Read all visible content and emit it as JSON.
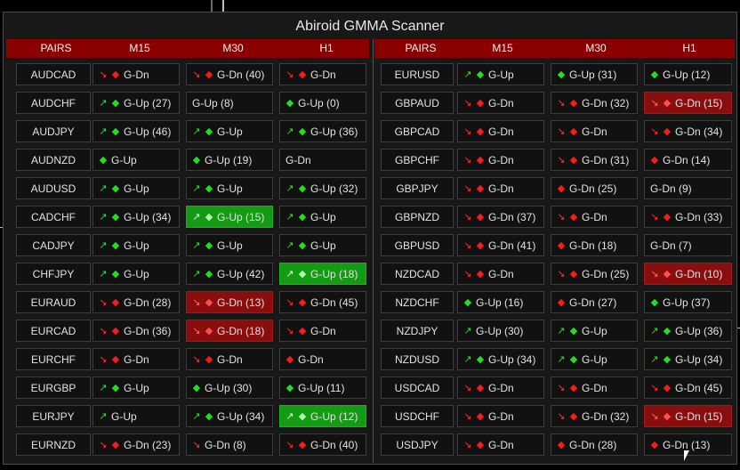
{
  "title": "Abiroid GMMA Scanner",
  "colors": {
    "header_bg": "#8b0000",
    "up": "#22dd22",
    "down": "#ff1a1a",
    "highlight_red": "#8b0e0e",
    "highlight_green": "#159a15"
  },
  "headers": [
    "PAIRS",
    "M15",
    "M30",
    "H1"
  ],
  "left": [
    {
      "pair": "AUDCAD",
      "cells": [
        {
          "arrow": "down",
          "dot": "down",
          "text": "G-Dn"
        },
        {
          "arrow": "down",
          "dot": "down",
          "text": "G-Dn (40)"
        },
        {
          "arrow": "down",
          "dot": "down",
          "text": "G-Dn"
        }
      ]
    },
    {
      "pair": "AUDCHF",
      "cells": [
        {
          "arrow": "up",
          "dot": "up",
          "text": "G-Up (27)"
        },
        {
          "arrow": "",
          "dot": "",
          "text": "G-Up (8)"
        },
        {
          "arrow": "",
          "dot": "up",
          "text": "G-Up (0)"
        }
      ]
    },
    {
      "pair": "AUDJPY",
      "cells": [
        {
          "arrow": "up",
          "dot": "up",
          "text": "G-Up (46)"
        },
        {
          "arrow": "up",
          "dot": "up",
          "text": "G-Up"
        },
        {
          "arrow": "up",
          "dot": "up",
          "text": "G-Up (36)"
        }
      ]
    },
    {
      "pair": "AUDNZD",
      "cells": [
        {
          "arrow": "",
          "dot": "up",
          "text": "G-Up"
        },
        {
          "arrow": "",
          "dot": "up",
          "text": "G-Up (19)"
        },
        {
          "arrow": "",
          "dot": "",
          "text": "G-Dn"
        }
      ]
    },
    {
      "pair": "AUDUSD",
      "cells": [
        {
          "arrow": "up",
          "dot": "up",
          "text": "G-Up"
        },
        {
          "arrow": "up",
          "dot": "up",
          "text": "G-Up"
        },
        {
          "arrow": "up",
          "dot": "up",
          "text": "G-Up (32)"
        }
      ]
    },
    {
      "pair": "CADCHF",
      "cells": [
        {
          "arrow": "up",
          "dot": "up",
          "text": "G-Up (34)"
        },
        {
          "arrow": "up",
          "dot": "up",
          "text": "G-Up (15)",
          "hl": "green"
        },
        {
          "arrow": "up",
          "dot": "up",
          "text": "G-Up"
        }
      ]
    },
    {
      "pair": "CADJPY",
      "cells": [
        {
          "arrow": "up",
          "dot": "up",
          "text": "G-Up"
        },
        {
          "arrow": "up",
          "dot": "up",
          "text": "G-Up"
        },
        {
          "arrow": "up",
          "dot": "up",
          "text": "G-Up"
        }
      ]
    },
    {
      "pair": "CHFJPY",
      "cells": [
        {
          "arrow": "up",
          "dot": "up",
          "text": "G-Up"
        },
        {
          "arrow": "up",
          "dot": "up",
          "text": "G-Up (42)"
        },
        {
          "arrow": "up",
          "dot": "up",
          "text": "G-Up (18)",
          "hl": "green"
        }
      ]
    },
    {
      "pair": "EURAUD",
      "cells": [
        {
          "arrow": "down",
          "dot": "down",
          "text": "G-Dn (28)"
        },
        {
          "arrow": "down",
          "dot": "down",
          "text": "G-Dn (13)",
          "hl": "red"
        },
        {
          "arrow": "down",
          "dot": "down",
          "text": "G-Dn (45)"
        }
      ]
    },
    {
      "pair": "EURCAD",
      "cells": [
        {
          "arrow": "down",
          "dot": "down",
          "text": "G-Dn (36)"
        },
        {
          "arrow": "down",
          "dot": "down",
          "text": "G-Dn (18)",
          "hl": "red"
        },
        {
          "arrow": "down",
          "dot": "down",
          "text": "G-Dn"
        }
      ]
    },
    {
      "pair": "EURCHF",
      "cells": [
        {
          "arrow": "down",
          "dot": "down",
          "text": "G-Dn"
        },
        {
          "arrow": "down",
          "dot": "down",
          "text": "G-Dn"
        },
        {
          "arrow": "",
          "dot": "down",
          "text": "G-Dn"
        }
      ]
    },
    {
      "pair": "EURGBP",
      "cells": [
        {
          "arrow": "up",
          "dot": "up",
          "text": "G-Up"
        },
        {
          "arrow": "",
          "dot": "up",
          "text": "G-Up (30)"
        },
        {
          "arrow": "",
          "dot": "up",
          "text": "G-Up (11)"
        }
      ]
    },
    {
      "pair": "EURJPY",
      "cells": [
        {
          "arrow": "up",
          "dot": "",
          "text": "G-Up"
        },
        {
          "arrow": "up",
          "dot": "up",
          "text": "G-Up (34)"
        },
        {
          "arrow": "up",
          "dot": "up",
          "text": "G-Up (12)",
          "hl": "green"
        }
      ]
    },
    {
      "pair": "EURNZD",
      "cells": [
        {
          "arrow": "down",
          "dot": "down",
          "text": "G-Dn (23)"
        },
        {
          "arrow": "down",
          "dot": "",
          "text": "G-Dn (8)"
        },
        {
          "arrow": "down",
          "dot": "down",
          "text": "G-Dn (40)"
        }
      ]
    }
  ],
  "right": [
    {
      "pair": "EURUSD",
      "cells": [
        {
          "arrow": "up",
          "dot": "up",
          "text": "G-Up"
        },
        {
          "arrow": "",
          "dot": "up",
          "text": "G-Up (31)"
        },
        {
          "arrow": "",
          "dot": "up",
          "text": "G-Up (12)"
        }
      ]
    },
    {
      "pair": "GBPAUD",
      "cells": [
        {
          "arrow": "down",
          "dot": "down",
          "text": "G-Dn"
        },
        {
          "arrow": "down",
          "dot": "down",
          "text": "G-Dn (32)"
        },
        {
          "arrow": "down",
          "dot": "down",
          "text": "G-Dn (15)",
          "hl": "red"
        }
      ]
    },
    {
      "pair": "GBPCAD",
      "cells": [
        {
          "arrow": "down",
          "dot": "down",
          "text": "G-Dn"
        },
        {
          "arrow": "down",
          "dot": "down",
          "text": "G-Dn"
        },
        {
          "arrow": "down",
          "dot": "down",
          "text": "G-Dn (34)"
        }
      ]
    },
    {
      "pair": "GBPCHF",
      "cells": [
        {
          "arrow": "down",
          "dot": "down",
          "text": "G-Dn"
        },
        {
          "arrow": "down",
          "dot": "down",
          "text": "G-Dn (31)"
        },
        {
          "arrow": "",
          "dot": "down",
          "text": "G-Dn (14)"
        }
      ]
    },
    {
      "pair": "GBPJPY",
      "cells": [
        {
          "arrow": "down",
          "dot": "down",
          "text": "G-Dn"
        },
        {
          "arrow": "",
          "dot": "down",
          "text": "G-Dn (25)"
        },
        {
          "arrow": "",
          "dot": "",
          "text": "G-Dn (9)"
        }
      ]
    },
    {
      "pair": "GBPNZD",
      "cells": [
        {
          "arrow": "down",
          "dot": "down",
          "text": "G-Dn (37)"
        },
        {
          "arrow": "down",
          "dot": "down",
          "text": "G-Dn"
        },
        {
          "arrow": "down",
          "dot": "down",
          "text": "G-Dn (33)"
        }
      ]
    },
    {
      "pair": "GBPUSD",
      "cells": [
        {
          "arrow": "down",
          "dot": "down",
          "text": "G-Dn (41)"
        },
        {
          "arrow": "",
          "dot": "down",
          "text": "G-Dn (18)"
        },
        {
          "arrow": "",
          "dot": "",
          "text": "G-Dn (7)"
        }
      ]
    },
    {
      "pair": "NZDCAD",
      "cells": [
        {
          "arrow": "down",
          "dot": "down",
          "text": "G-Dn"
        },
        {
          "arrow": "down",
          "dot": "down",
          "text": "G-Dn (25)"
        },
        {
          "arrow": "down",
          "dot": "down",
          "text": "G-Dn (10)",
          "hl": "red"
        }
      ]
    },
    {
      "pair": "NZDCHF",
      "cells": [
        {
          "arrow": "",
          "dot": "up",
          "text": "G-Up (16)"
        },
        {
          "arrow": "",
          "dot": "down",
          "text": "G-Dn (27)"
        },
        {
          "arrow": "",
          "dot": "up",
          "text": "G-Up (37)"
        }
      ]
    },
    {
      "pair": "NZDJPY",
      "cells": [
        {
          "arrow": "up",
          "dot": "",
          "text": "G-Up (30)"
        },
        {
          "arrow": "up",
          "dot": "up",
          "text": "G-Up"
        },
        {
          "arrow": "up",
          "dot": "up",
          "text": "G-Up (36)"
        }
      ]
    },
    {
      "pair": "NZDUSD",
      "cells": [
        {
          "arrow": "up",
          "dot": "up",
          "text": "G-Up (34)"
        },
        {
          "arrow": "up",
          "dot": "up",
          "text": "G-Up"
        },
        {
          "arrow": "up",
          "dot": "up",
          "text": "G-Up (34)"
        }
      ]
    },
    {
      "pair": "USDCAD",
      "cells": [
        {
          "arrow": "down",
          "dot": "down",
          "text": "G-Dn"
        },
        {
          "arrow": "down",
          "dot": "down",
          "text": "G-Dn"
        },
        {
          "arrow": "down",
          "dot": "down",
          "text": "G-Dn (45)"
        }
      ]
    },
    {
      "pair": "USDCHF",
      "cells": [
        {
          "arrow": "down",
          "dot": "down",
          "text": "G-Dn"
        },
        {
          "arrow": "down",
          "dot": "down",
          "text": "G-Dn (32)"
        },
        {
          "arrow": "down",
          "dot": "down",
          "text": "G-Dn (15)",
          "hl": "red"
        }
      ]
    },
    {
      "pair": "USDJPY",
      "cells": [
        {
          "arrow": "down",
          "dot": "down",
          "text": "G-Dn"
        },
        {
          "arrow": "",
          "dot": "down",
          "text": "G-Dn (28)"
        },
        {
          "arrow": "",
          "dot": "down",
          "text": "G-Dn (13)"
        }
      ]
    }
  ]
}
